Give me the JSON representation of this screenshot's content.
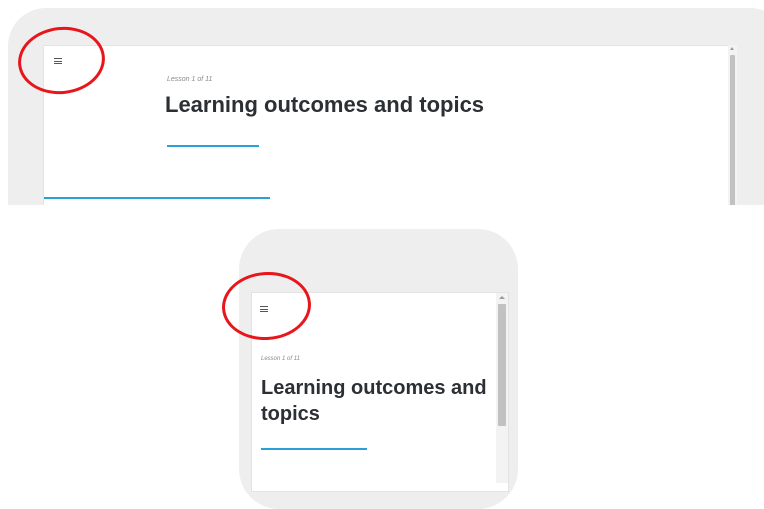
{
  "tablet_view": {
    "menu_icon": "hamburger-menu-icon",
    "lesson_counter": "Lesson 1 of 11",
    "lesson_title": "Learning outcomes and topics"
  },
  "phone_view": {
    "menu_icon": "hamburger-menu-icon",
    "lesson_counter": "Lesson 1 of 11",
    "lesson_title": "Learning outcomes and topics"
  },
  "colors": {
    "accent_blue": "#2a9fd8",
    "annotation_red": "#e8151b",
    "device_frame": "#eeeeee",
    "title_text": "#2c2f33"
  }
}
